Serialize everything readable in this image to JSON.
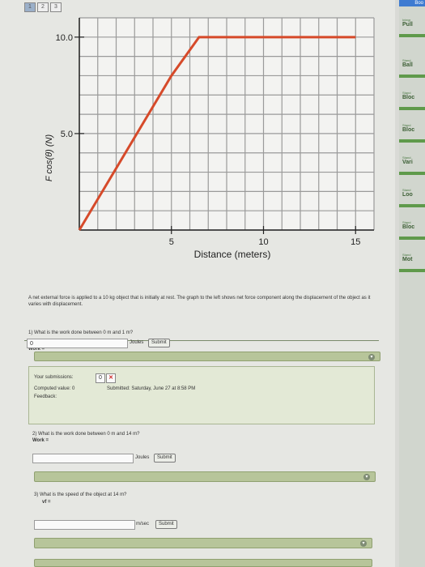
{
  "tabs": [
    "1",
    "2",
    "3"
  ],
  "chart_data": {
    "type": "line",
    "x": [
      0,
      5,
      6.5,
      15
    ],
    "y": [
      0,
      8,
      10,
      10
    ],
    "xlabel": "Distance (meters)",
    "ylabel": "F cos(θ) (N)",
    "x_ticks": [
      "5",
      "10",
      "15"
    ],
    "y_ticks": [
      "10.0",
      "5.0"
    ],
    "xlim": [
      0,
      16
    ],
    "ylim": [
      0,
      11
    ],
    "grid": true,
    "line_color": "#d64a2a"
  },
  "problem_text": "A net external force is applied to a 10 kg object that is initially at rest. The graph to the left shows net force component along the displacement of the object as it varies with displacement.",
  "q1": {
    "question": "1) What is the work done between 0 m and 1 m?",
    "label": "Work =",
    "value": "0",
    "units": "Joules",
    "submit": "Submit"
  },
  "submissions": {
    "label": "Your submissions:",
    "entry": "0",
    "status": "✕",
    "computed": "Computed value: 0",
    "submitted": "Submitted: Saturday, June 27 at 8:58 PM",
    "feedback": "Feedback:"
  },
  "q2": {
    "question": "2) What is the work done between 0 m and 14 m?",
    "label": "Work =",
    "value": "",
    "units": "Joules",
    "submit": "Submit"
  },
  "q3": {
    "question": "3) What is the speed of the object at 14 m?",
    "label": "vf =",
    "value": "",
    "units": "m/sec",
    "submit": "Submit"
  },
  "sidebar": {
    "top": "Boo",
    "items": [
      {
        "small": "Integr",
        "label": "Pull"
      },
      {
        "small": "Stand",
        "label": "Ball"
      },
      {
        "small": "Stand",
        "label": "Bloc"
      },
      {
        "small": "Stand",
        "label": "Bloc"
      },
      {
        "small": "Stand",
        "label": "Vari"
      },
      {
        "small": "Stand",
        "label": "Loo"
      },
      {
        "small": "Stand",
        "label": "Bloc"
      },
      {
        "small": "Stand",
        "label": "Mot"
      }
    ]
  }
}
